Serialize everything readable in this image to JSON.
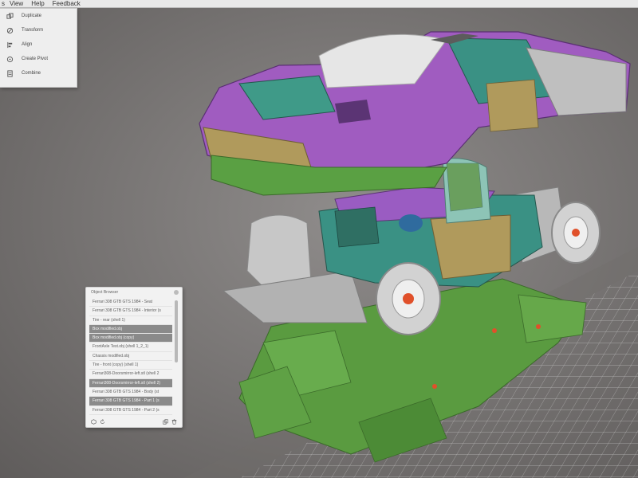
{
  "menubar": {
    "items": [
      "s",
      "View",
      "Help",
      "Feedback"
    ]
  },
  "tools_menu": {
    "items": [
      {
        "label": "Duplicate",
        "icon": "duplicate-icon"
      },
      {
        "label": "Transform",
        "icon": "transform-icon"
      },
      {
        "label": "Align",
        "icon": "align-icon"
      },
      {
        "label": "Create Pivot",
        "icon": "pivot-icon"
      },
      {
        "label": "Combine",
        "icon": "combine-icon"
      }
    ]
  },
  "object_browser": {
    "title": "Object Browser",
    "rows": [
      {
        "label": "Ferrari 308 GTB GTS 1984 - Seat",
        "selected": false
      },
      {
        "label": "Ferrari 308 GTB GTS 1984 - Interior (s",
        "selected": false
      },
      {
        "label": "Tire - rear (shell 1)",
        "selected": false
      },
      {
        "label": "Box modified.obj",
        "selected": true
      },
      {
        "label": "Box modified.obj (copy)",
        "selected": true
      },
      {
        "label": "FrontAxle Test.obj (shell 1_2_1)",
        "selected": false
      },
      {
        "label": "Chassis modified.obj",
        "selected": false
      },
      {
        "label": "Tire - front (copy) (shell 1)",
        "selected": false
      },
      {
        "label": "Ferrari308-Doorsmirror-left.stl (shell 2",
        "selected": false
      },
      {
        "label": "Ferrari308-Doorsmirror-left.stl (shell 2)",
        "selected": true
      },
      {
        "label": "Ferrari 308 GTB GTS 1984 - Body (st",
        "selected": false
      },
      {
        "label": "Ferrari 308 GTB GTS 1984 - Part 1 (s",
        "selected": true
      },
      {
        "label": "Ferrari 308 GTB GTS 1984 - Part 2 (s",
        "selected": false
      }
    ],
    "footer_icons": [
      "cube-icon",
      "refresh-icon",
      "copy-icon",
      "trash-icon"
    ]
  },
  "colors": {
    "body_magenta": "#a05cc0",
    "teal": "#3f9a88",
    "olive": "#b09a5c",
    "green": "#5aa043",
    "grey": "#b5b5b5",
    "orange": "#e0502a"
  }
}
